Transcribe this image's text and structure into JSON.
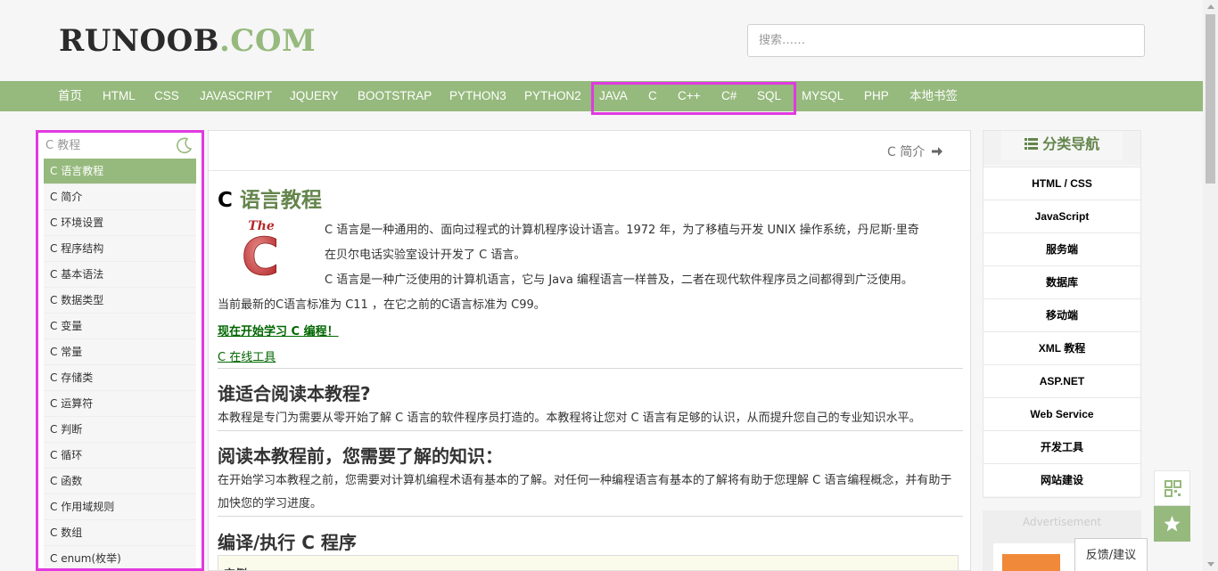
{
  "header": {
    "logo_part1": "RUNOOB",
    "logo_part2": ".COM",
    "search_placeholder": "搜索……"
  },
  "nav": {
    "items": [
      "首页",
      "HTML",
      "CSS",
      "JAVASCRIPT",
      "JQUERY",
      "BOOTSTRAP",
      "PYTHON3",
      "PYTHON2",
      "JAVA",
      "C",
      "C++",
      "C#",
      "SQL",
      "MYSQL",
      "PHP",
      "本地书签"
    ]
  },
  "left_sidebar": {
    "title": "C 教程",
    "items": [
      "C 语言教程",
      "C 简介",
      "C 环境设置",
      "C 程序结构",
      "C 基本语法",
      "C 数据类型",
      "C 变量",
      "C 常量",
      "C 存储类",
      "C 运算符",
      "C 判断",
      "C 循环",
      "C 函数",
      "C 作用域规则",
      "C 数组",
      "C enum(枚举)"
    ],
    "active_index": 0
  },
  "main": {
    "next_link": "C 简介",
    "title_prefix": "C",
    "title_rest": "语言教程",
    "logo_text": "The",
    "logo_letter": "C",
    "intro_line1": "C 语言是一种通用的、面向过程式的计算机程序设计语言。1972 年，为了移植与开发 UNIX 操作系统，丹尼斯·里奇",
    "intro_line2": "在贝尔电话实验室设计开发了 C 语言。",
    "intro_line3": "C 语言是一种广泛使用的计算机语言，它与 Java 编程语言一样普及，二者在现代软件程序员之间都得到广泛使用。",
    "intro_line4": "当前最新的C语言标准为 C11 ，在它之前的C语言标准为 C99。",
    "start_link": "现在开始学习 C 编程！",
    "tool_link": "C 在线工具",
    "h2_audience": "谁适合阅读本教程?",
    "audience_text": "本教程是专门为需要从零开始了解 C 语言的软件程序员打造的。本教程将让您对 C 语言有足够的认识，从而提升您自己的专业知识水平。",
    "h2_prereq": "阅读本教程前，您需要了解的知识：",
    "prereq_line1": "在开始学习本教程之前，您需要对计算机编程术语有基本的了解。对任何一种编程语言有基本的了解将有助于您理解 C 语言编程概念，并有助于",
    "prereq_line2": "加快您的学习进度。",
    "h2_compile": "编译/执行 C 程序",
    "example_label": "实例"
  },
  "right_sidebar": {
    "title": "分类导航",
    "items": [
      "HTML / CSS",
      "JavaScript",
      "服务端",
      "数据库",
      "移动端",
      "XML 教程",
      "ASP.NET",
      "Web Service",
      "开发工具",
      "网站建设"
    ]
  },
  "ad": {
    "label": "Advertisement"
  },
  "feedback": {
    "label": "反馈/建议"
  },
  "colors": {
    "brand_green": "#96b97d",
    "title_green": "#64854c",
    "highlight": "#e03ae0"
  },
  "icons": {
    "moon": "moon-icon",
    "arrow": "arrow-right-icon",
    "list": "list-icon",
    "qr": "qr-code-icon",
    "star": "star-icon"
  }
}
